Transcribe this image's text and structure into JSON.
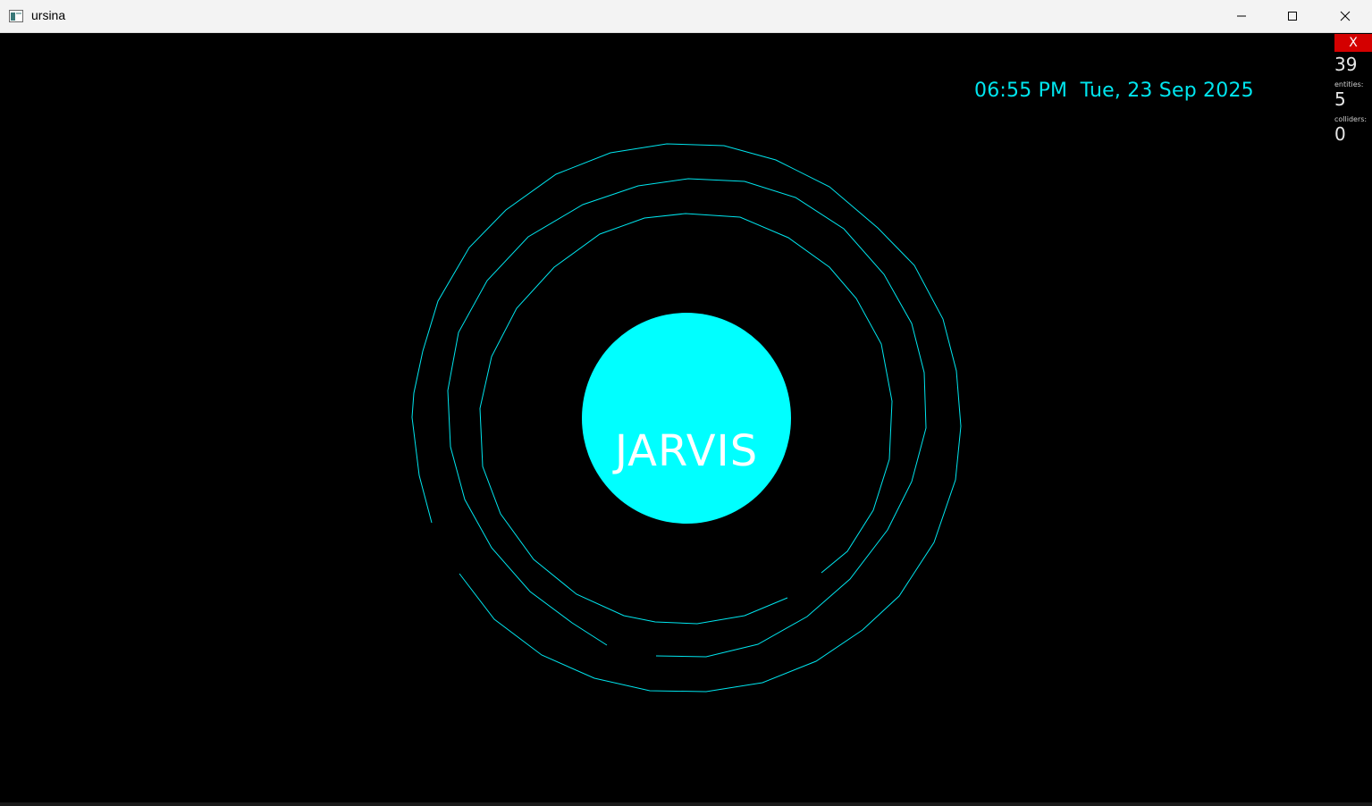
{
  "window": {
    "title": "ursina"
  },
  "hud": {
    "time": "06:55 PM",
    "date": "Tue, 23 Sep 2025"
  },
  "debug": {
    "exit_label": "X",
    "fps": "39",
    "entities_label": "entities:",
    "entities_count": "5",
    "colliders_label": "colliders:",
    "colliders_count": "0"
  },
  "core": {
    "label": "JARVIS",
    "color": "#00ffff"
  },
  "colors": {
    "ring": "#00e5ee",
    "debug_exit": "#d40000",
    "background": "#000000"
  }
}
